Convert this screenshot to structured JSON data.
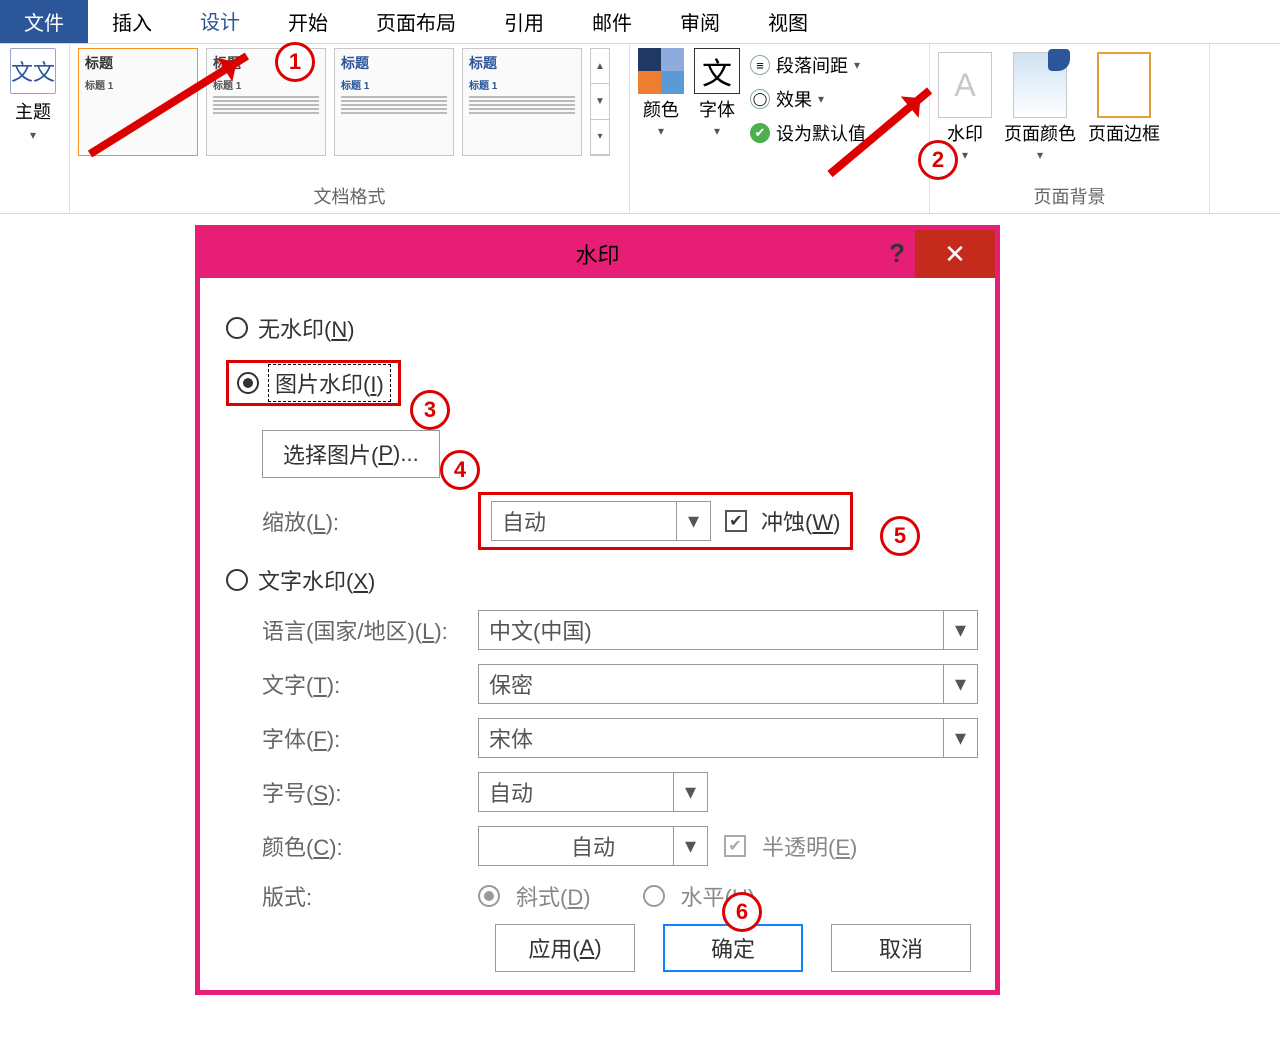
{
  "ribbon": {
    "tabs": {
      "file": "文件",
      "insert": "插入",
      "design": "设计",
      "start": "开始",
      "layout": "页面布局",
      "reference": "引用",
      "mail": "邮件",
      "review": "审阅",
      "view": "视图"
    },
    "themes": "主题",
    "doc_format_label": "文档格式",
    "colors": "颜色",
    "fonts": "字体",
    "para_spacing": "段落间距",
    "effects": "效果",
    "set_default": "设为默认值",
    "watermark": "水印",
    "page_color": "页面颜色",
    "page_border": "页面边框",
    "page_bg_label": "页面背景",
    "style_thumb_title": "标题",
    "style_thumb_h1": "标题 1"
  },
  "anno": {
    "c1": "1",
    "c2": "2",
    "c3": "3",
    "c4": "4",
    "c5": "5",
    "c6": "6"
  },
  "dialog": {
    "title": "水印",
    "no_watermark": "无水印(N)",
    "pic_watermark": "图片水印(I)",
    "select_pic": "选择图片(P)...",
    "scale_label": "缩放(L):",
    "scale_value": "自动",
    "washout": "冲蚀(W)",
    "text_watermark": "文字水印(X)",
    "lang_label": "语言(国家/地区)(L):",
    "lang_value": "中文(中国)",
    "text_label": "文字(T):",
    "text_value": "保密",
    "font_label": "字体(F):",
    "font_value": "宋体",
    "size_label": "字号(S):",
    "size_value": "自动",
    "color_label": "颜色(C):",
    "color_value": "自动",
    "semi": "半透明(E)",
    "layout_label": "版式:",
    "diag": "斜式(D)",
    "horiz": "水平(H)",
    "apply": "应用(A)",
    "ok": "确定",
    "cancel": "取消"
  }
}
